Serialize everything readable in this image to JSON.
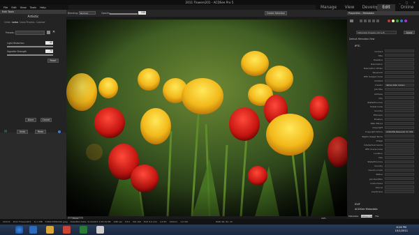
{
  "window": {
    "title": "2011 Flowers201 - ACDSee Pro 5",
    "controls": "_ ▢ ✕"
  },
  "menu": [
    "File",
    "Edit",
    "View",
    "Tools",
    "Help"
  ],
  "modes": [
    {
      "label": "Manage"
    },
    {
      "label": "View"
    },
    {
      "label": "Develop"
    },
    {
      "label": "Edit",
      "active": true
    },
    {
      "label": "Online"
    }
  ],
  "left_panel": {
    "header": "Edit Tools",
    "tool_title": "Artistic",
    "tabs": [
      "Orton",
      "Lomo",
      "Cross Process",
      "Colorize",
      "Fast Edges"
    ],
    "presets_label": "Presets:",
    "lighting_label": "Light Distortion",
    "lighting_value": "40",
    "vignette_label": "Vignette Strength",
    "vignette_value": "70",
    "reset": "Reset",
    "done": "Done",
    "cancel": "Cancel",
    "undo": "Undo",
    "redo": "Redo"
  },
  "toolbar": {
    "blending_label": "Blending:",
    "blending_value": "Normal",
    "opacity_label": "Opacity:",
    "opacity_value": "100",
    "create_selection": "Create Selection"
  },
  "viewer": {
    "show_preview": "Show Preview",
    "zoom": "44%"
  },
  "right_panel": {
    "header": "Properties - Metadata",
    "view_select": "Metadata Presets (Ctrl+E)",
    "apply": "Apply",
    "sections": {
      "default": "Default Metadata View",
      "iptc": "IPTC",
      "exif": "EXIF",
      "acdsee": "ACDSee Metadata"
    },
    "fields": [
      {
        "k": "Contact",
        "v": ""
      },
      {
        "k": "Title",
        "v": ""
      },
      {
        "k": "Headline",
        "v": ""
      },
      {
        "k": "Description",
        "v": ""
      },
      {
        "k": "Description Writer",
        "v": ""
      },
      {
        "k": "Keywords",
        "v": ""
      },
      {
        "k": "IPTC Subject Code",
        "v": ""
      },
      {
        "k": "Content",
        "v": ""
      },
      {
        "k": "Creator",
        "v": "James Allen Larsen"
      },
      {
        "k": "Job Title",
        "v": ""
      },
      {
        "k": "Address",
        "v": ""
      },
      {
        "k": "City",
        "v": ""
      },
      {
        "k": "State/Province",
        "v": ""
      },
      {
        "k": "Postal Code",
        "v": ""
      },
      {
        "k": "Country",
        "v": ""
      },
      {
        "k": "Phone(s)",
        "v": ""
      },
      {
        "k": "Email(s)",
        "v": ""
      },
      {
        "k": "Web URL(s)",
        "v": ""
      },
      {
        "k": "Copyright",
        "v": ""
      },
      {
        "k": "Copyright Notice",
        "v": "All Rights Reserved (C) 2011"
      },
      {
        "k": "Rights Usage Terms",
        "v": ""
      },
      {
        "k": "Image",
        "v": ""
      },
      {
        "k": "Intellectual Genre",
        "v": ""
      },
      {
        "k": "IPTC Scene Code",
        "v": ""
      },
      {
        "k": "Location",
        "v": ""
      },
      {
        "k": "City",
        "v": ""
      },
      {
        "k": "State/Province",
        "v": ""
      },
      {
        "k": "Country",
        "v": ""
      },
      {
        "k": "Country Code",
        "v": ""
      },
      {
        "k": "Status",
        "v": ""
      },
      {
        "k": "Job Identifier",
        "v": ""
      },
      {
        "k": "Instructions",
        "v": ""
      },
      {
        "k": "Source",
        "v": ""
      },
      {
        "k": "Credit Line",
        "v": ""
      }
    ],
    "bottom_tabs": [
      "Metadata",
      "Categories",
      "File"
    ]
  },
  "status": [
    "20/115",
    "2011 Flowers201",
    "11.1 MB",
    "5184x3456x24b jpeg",
    "Date/Mod Date: 5/12/2011 3:35:29 PM",
    "1/80 sec",
    "f/4.0",
    "ISO 100",
    "Exif: 9.0 mm",
    "4.0 EV",
    "100mm",
    "1.0 ISO",
    "RGB: 66, 82, 43"
  ],
  "taskbar": {
    "time": "6:26 PM",
    "date": "10/1/2011"
  },
  "colors": {
    "accent": "#3a7bd5",
    "panel": "#232323"
  }
}
